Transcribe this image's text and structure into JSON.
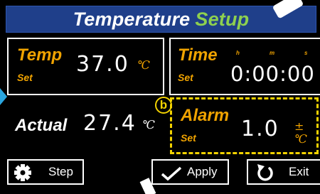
{
  "title": {
    "part1": "Temperature",
    "part2": "Setup"
  },
  "temp_set": {
    "label": "Temp",
    "sublabel": "Set",
    "value": "37.0",
    "unit": "℃"
  },
  "time_set": {
    "label": "Time",
    "sublabel": "Set",
    "value": "0:00:00",
    "h_label": "h",
    "m_label": "m",
    "s_label": "s"
  },
  "actual": {
    "label": "Actual",
    "value": "27.4",
    "unit": "℃"
  },
  "alarm_set": {
    "label": "Alarm",
    "sublabel": "Set",
    "value": "1.0",
    "unit": "±℃"
  },
  "callout": {
    "marker": "b"
  },
  "buttons": {
    "step": "Step",
    "apply": "Apply",
    "exit": "Exit"
  },
  "colors": {
    "background": "#000000",
    "title_bar": "#1f3f8a",
    "title_accent": "#8ed04f",
    "label_orange": "#f0a300",
    "highlight_yellow": "#f2d200",
    "side_marker": "#2aa6e0"
  },
  "icons": {
    "step": "gear-icon",
    "apply": "checkmark-icon",
    "exit": "return-arrow-icon"
  }
}
